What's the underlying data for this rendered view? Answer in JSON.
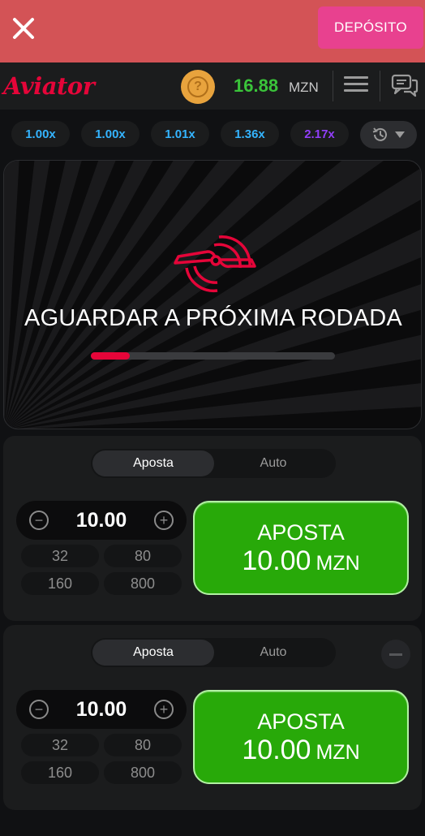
{
  "topbar": {
    "deposit_label": "DEPÓSITO",
    "brand_color": "#d35356"
  },
  "header": {
    "logo": "Aviator",
    "help_glyph": "?",
    "balance": "16.88",
    "currency": "MZN"
  },
  "history": {
    "items": [
      {
        "value": "1.00x",
        "color": "#34b4ff"
      },
      {
        "value": "1.00x",
        "color": "#34b4ff"
      },
      {
        "value": "1.01x",
        "color": "#34b4ff"
      },
      {
        "value": "1.36x",
        "color": "#34b4ff"
      },
      {
        "value": "2.17x",
        "color": "#913ef8"
      }
    ]
  },
  "game": {
    "status_text": "AGUARDAR A PRÓXIMA RODADA",
    "progress": 0.16,
    "accent_color": "#e50539"
  },
  "panels": [
    {
      "tabs": [
        "Aposta",
        "Auto"
      ],
      "active_tab": "Aposta",
      "stake": "10.00",
      "quick_bets": [
        "32",
        "80",
        "160",
        "800"
      ],
      "bet_button": {
        "label": "APOSTA",
        "amount": "10.00",
        "currency": "MZN"
      }
    },
    {
      "tabs": [
        "Aposta",
        "Auto"
      ],
      "active_tab": "Aposta",
      "stake": "10.00",
      "quick_bets": [
        "32",
        "80",
        "160",
        "800"
      ],
      "bet_button": {
        "label": "APOSTA",
        "amount": "10.00",
        "currency": "MZN"
      }
    }
  ]
}
